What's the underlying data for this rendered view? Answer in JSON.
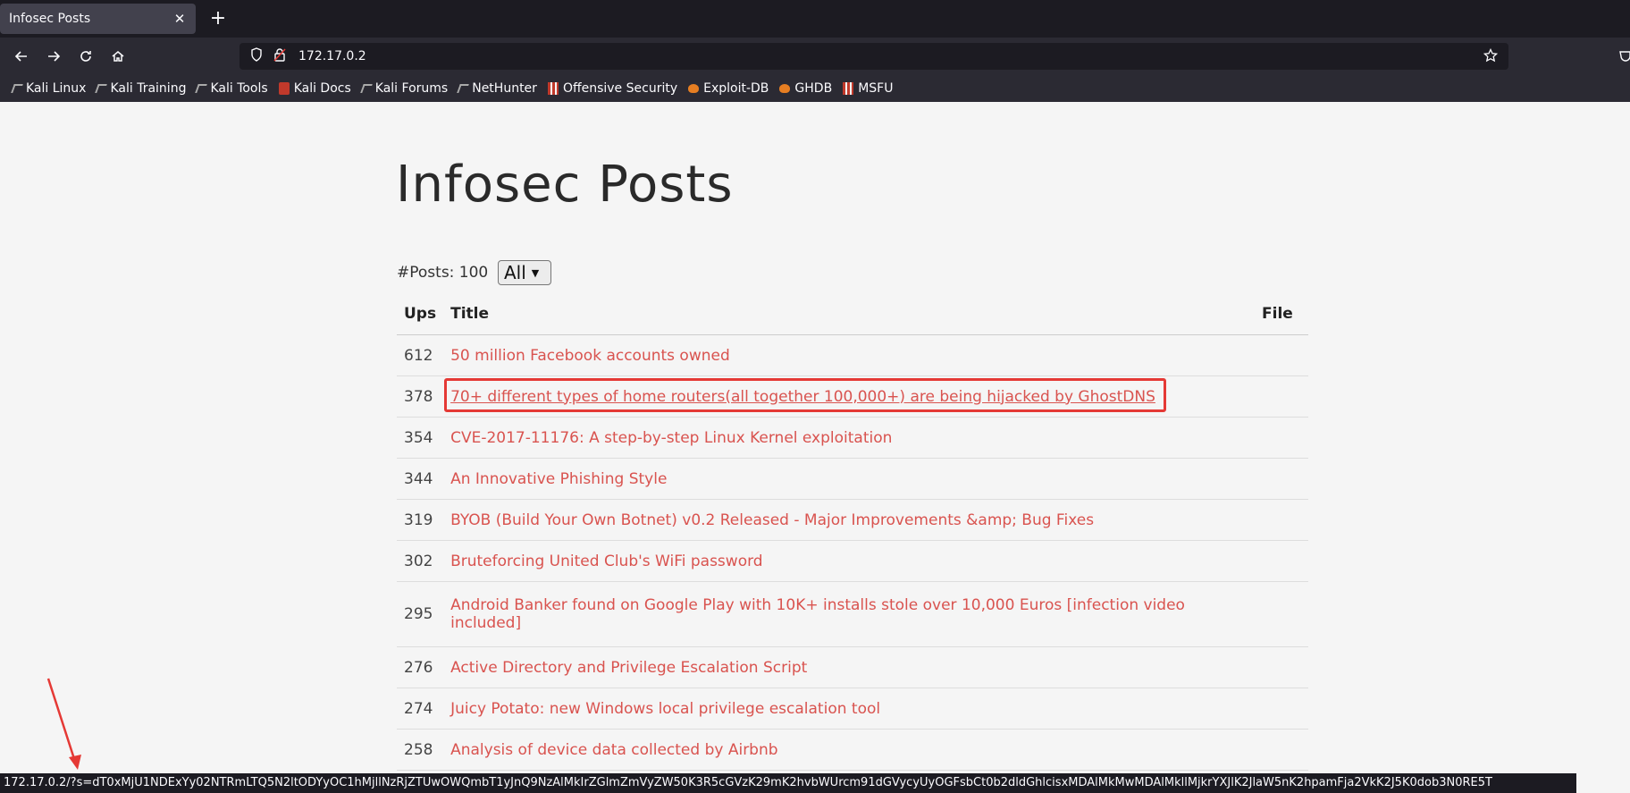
{
  "browser": {
    "tab_title": "Infosec Posts",
    "url": "172.17.0.2",
    "bookmarks": [
      {
        "label": "Kali Linux",
        "icon": "kali-dragon-icon"
      },
      {
        "label": "Kali Training",
        "icon": "kali-dragon-icon"
      },
      {
        "label": "Kali Tools",
        "icon": "kali-dragon-icon"
      },
      {
        "label": "Kali Docs",
        "icon": "kali-docs-icon"
      },
      {
        "label": "Kali Forums",
        "icon": "kali-dragon-icon"
      },
      {
        "label": "NetHunter",
        "icon": "nethunter-icon"
      },
      {
        "label": "Offensive Security",
        "icon": "offsec-icon"
      },
      {
        "label": "Exploit-DB",
        "icon": "exploitdb-icon"
      },
      {
        "label": "GHDB",
        "icon": "ghdb-icon"
      },
      {
        "label": "MSFU",
        "icon": "msfu-icon"
      }
    ],
    "status_url": "172.17.0.2/?s=dT0xMjU1NDExYy02NTRmLTQ5N2ltODYyOC1hMjllNzRjZTUwOWQmbT1yJnQ9NzAlMkIrZGlmZmVyZW50K3R5cGVzK29mK2hvbWUrcm91dGVycyUyOGFsbCt0b2dldGhlcisxMDAlMkMwMDAlMkllMjkrYXJlK2JlaW5nK2hpamFja2VkK2J5K0dob3N0RE5T"
  },
  "page": {
    "heading": "Infosec Posts",
    "posts_count_label": "#Posts: 100",
    "filter_value": "All",
    "columns": {
      "ups": "Ups",
      "title": "Title",
      "file": "File"
    },
    "rows": [
      {
        "ups": "612",
        "title": "50 million Facebook accounts owned"
      },
      {
        "ups": "378",
        "title": "70+ different types of home routers(all together 100,000+) are being hijacked by GhostDNS"
      },
      {
        "ups": "354",
        "title": "CVE-2017-11176: A step-by-step Linux Kernel exploitation"
      },
      {
        "ups": "344",
        "title": "An Innovative Phishing Style"
      },
      {
        "ups": "319",
        "title": "BYOB (Build Your Own Botnet) v0.2 Released - Major Improvements &amp; Bug Fixes"
      },
      {
        "ups": "302",
        "title": "Bruteforcing United Club's WiFi password"
      },
      {
        "ups": "295",
        "title": "Android Banker found on Google Play with 10K+ installs stole over 10,000 Euros [infection video included]"
      },
      {
        "ups": "276",
        "title": "Active Directory and Privilege Escalation Script"
      },
      {
        "ups": "274",
        "title": "Juicy Potato: new Windows local privilege escalation tool"
      },
      {
        "ups": "258",
        "title": "Analysis of device data collected by Airbnb"
      }
    ]
  },
  "colors": {
    "link": "#d9534f",
    "annotation": "#e53935",
    "chrome_dark": "#1c1b22",
    "chrome": "#2b2a33"
  }
}
